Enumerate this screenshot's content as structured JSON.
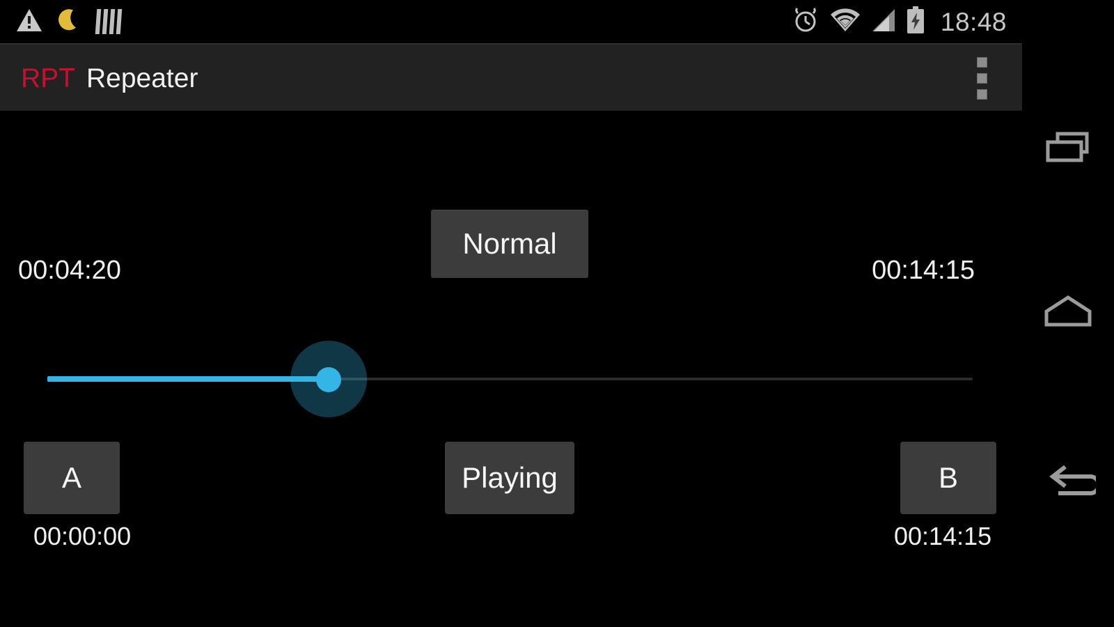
{
  "status_bar": {
    "notification_icons": [
      "warning-triangle-icon",
      "night-mode-moon-icon",
      "bars-icon"
    ],
    "system_icons": [
      "alarm-clock-icon",
      "wifi-icon",
      "cellular-signal-icon",
      "battery-charging-icon"
    ],
    "clock": "18:48"
  },
  "action_bar": {
    "logo_text": "RPT",
    "logo_color": "#c4112f",
    "title": "Repeater",
    "overflow_label": "More options",
    "background_color": "#222222"
  },
  "player": {
    "speed_button_label": "Normal",
    "current_time": "00:04:20",
    "total_time": "00:14:15",
    "seekbar": {
      "progress_percent": 30.4,
      "min_label": "00:04:20",
      "max_label": "00:14:15",
      "fill_color": "#33b5e5",
      "track_color": "#2c2c2c"
    },
    "marker_a_label": "A",
    "marker_a_time": "00:00:00",
    "play_button_label": "Playing",
    "marker_b_label": "B",
    "marker_b_time": "00:14:15"
  },
  "navigation_bar": {
    "recent_label": "Recent apps",
    "home_label": "Home",
    "back_label": "Back"
  }
}
